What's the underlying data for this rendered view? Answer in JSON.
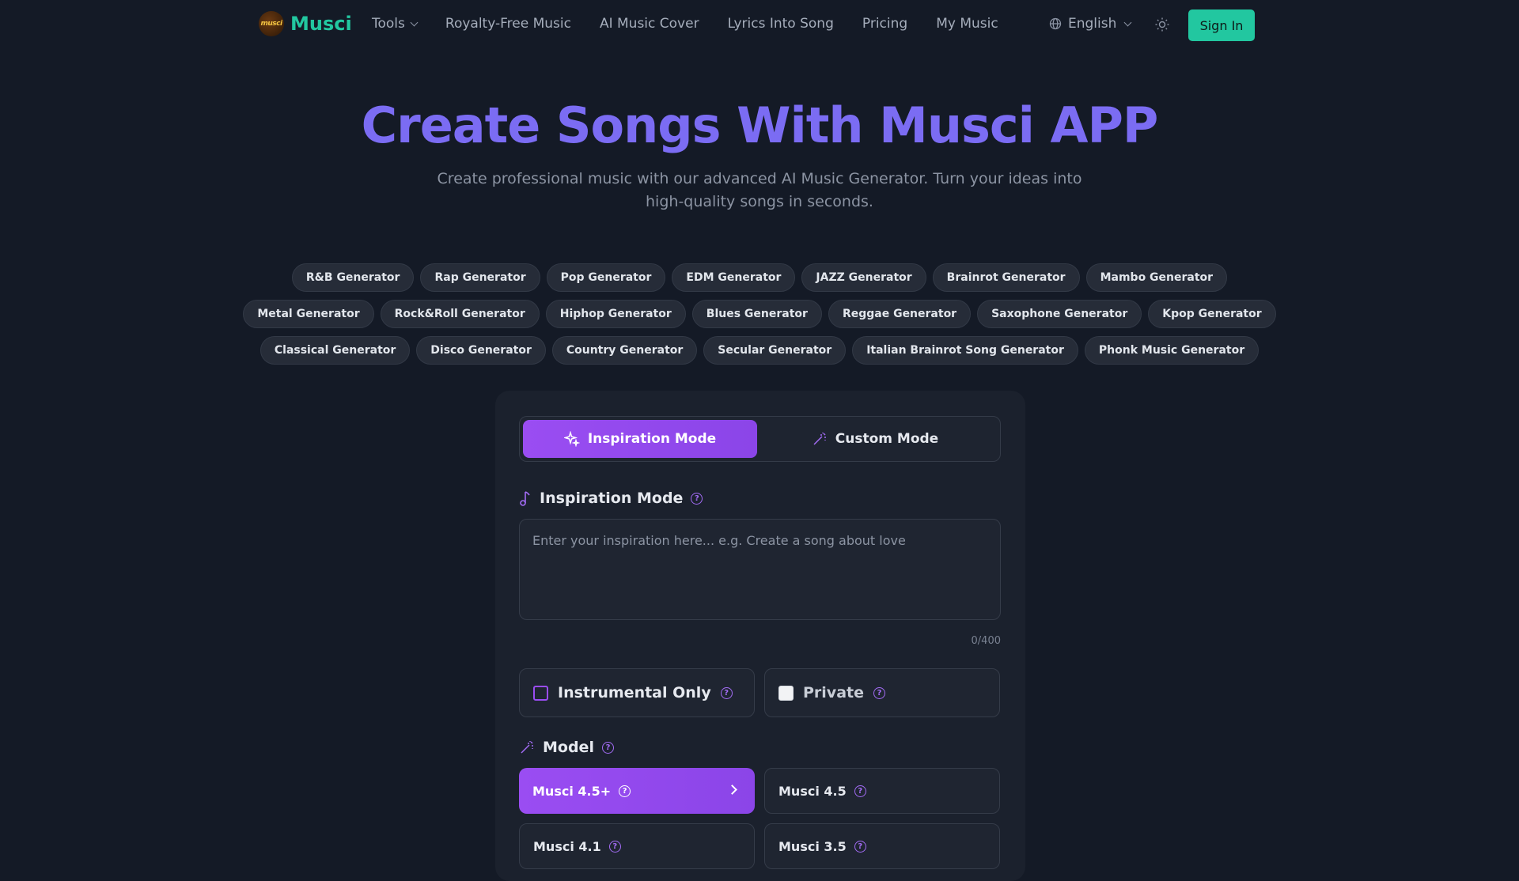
{
  "brand": {
    "logo_mark": "musci",
    "name": "Musci"
  },
  "nav": {
    "tools": "Tools",
    "links": [
      "Royalty-Free Music",
      "AI Music Cover",
      "Lyrics Into Song",
      "Pricing",
      "My Music"
    ],
    "language": "English",
    "sign_in": "Sign In"
  },
  "hero": {
    "title": "Create Songs With Musci APP",
    "subtitle": "Create professional music with our advanced AI Music Generator. Turn your ideas into high-quality songs in seconds."
  },
  "generators": {
    "row1": [
      "R&B Generator",
      "Rap Generator",
      "Pop Generator",
      "EDM Generator",
      "JAZZ Generator",
      "Brainrot Generator",
      "Mambo Generator"
    ],
    "row2": [
      "Metal Generator",
      "Rock&Roll Generator",
      "Hiphop Generator",
      "Blues Generator",
      "Reggae Generator",
      "Saxophone Generator",
      "Kpop Generator"
    ],
    "row3": [
      "Classical Generator",
      "Disco Generator",
      "Country Generator",
      "Secular Generator",
      "Italian Brainrot Song Generator",
      "Phonk Music Generator"
    ]
  },
  "panel": {
    "modes": {
      "inspiration": "Inspiration Mode",
      "custom": "Custom Mode",
      "active": "inspiration"
    },
    "inspiration_label": "Inspiration Mode",
    "inspiration_placeholder": "Enter your inspiration here... e.g. Create a song about love",
    "inspiration_value": "",
    "counter": "0/400",
    "instrumental_label": "Instrumental Only",
    "private_label": "Private",
    "model_label": "Model",
    "models": [
      "Musci 4.5+",
      "Musci 4.5",
      "Musci 4.1",
      "Musci 3.5"
    ],
    "selected_model": "Musci 4.5+"
  },
  "colors": {
    "background": "#141a26",
    "brand": "#22c7a0",
    "title": "#7b6cf3",
    "accent": "#9a4df2"
  }
}
